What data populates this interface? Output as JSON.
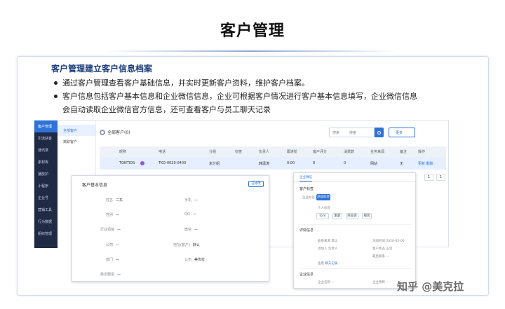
{
  "page": {
    "title": "客户管理",
    "card_heading": "客户管理建立客户信息档案",
    "bullet1": "通过客户管理查看客户基础信息，并实时更新客户资料，维护客户档案。",
    "bullet2a": "客户信息包括客户基本信息和企业微信信息，企业可根据客户情况进行客户基本信息填写，企业微信信息",
    "bullet2b": "会自动读取企业微信官方信息，还可查看客户与员工聊天记录",
    "watermark": "知乎 @美克拉"
  },
  "app": {
    "sidenav": [
      "客户管理",
      "引流获客",
      "通讯录",
      "素材库",
      "播放护",
      "小程序",
      "企业号",
      "营销工具",
      "行为数据",
      "组织管理"
    ],
    "subnav": [
      "全部客户",
      "离职客户"
    ],
    "toolbar": {
      "title": "全部客户(0)",
      "search_type": "搜索",
      "search_placeholder": "搜索",
      "more_label": "更多"
    },
    "columns": [
      "昵称",
      "电话",
      "分组",
      "标签",
      "负责人",
      "跟进阶",
      "客户评分",
      "消费数",
      "业务来源",
      "备注",
      "操作"
    ],
    "row": [
      "TONTIDS",
      "TKO-0020-0400",
      "未分组",
      "",
      "韩潇涛",
      "0.00",
      "0",
      "0",
      "网站",
      "无",
      "更新 删除"
    ],
    "pager": [
      "1",
      "1"
    ]
  },
  "pop_left": {
    "title": "客户基本信息",
    "edit": "已修改",
    "fields": [
      {
        "label": "姓名",
        "value": "二东"
      },
      {
        "label": "性别",
        "value": "—"
      },
      {
        "label": "行业领域",
        "value": "—"
      },
      {
        "label": "公司",
        "value": "—"
      },
      {
        "label": "部门",
        "value": "—"
      },
      {
        "label": "最近跟进",
        "value": "—"
      },
      {
        "label": "手机",
        "value": "—"
      },
      {
        "label": "QQ",
        "value": "—"
      },
      {
        "label": "微信",
        "value": "—"
      },
      {
        "label": "地址(客户)",
        "value": "默认"
      },
      {
        "label": "公司",
        "value": "美优拉"
      }
    ]
  },
  "pop_right": {
    "tab": "企业微信",
    "sec1": "客户标签",
    "tag_label": "企业标签",
    "tag_sel": "添加标签",
    "sec1b": "个人标签",
    "chips": [
      "tom",
      "家庭",
      "商业会",
      "服装"
    ],
    "sec2": "详情信息",
    "info": [
      {
        "label": "联系来源",
        "value": "默认"
      },
      {
        "label": "添加时间",
        "value": "2020-05-06"
      },
      {
        "label": "添加人",
        "value": "负责人"
      },
      {
        "label": "客户状态",
        "value": "正常"
      },
      {
        "label": "最后联系",
        "value": "—"
      },
      {
        "label": "查看",
        "value": "聊天记录"
      }
    ],
    "sec3": "企业信息",
    "info3": [
      {
        "label": "企业名称",
        "value": "—"
      },
      {
        "label": "企业简称",
        "value": "—"
      }
    ]
  }
}
